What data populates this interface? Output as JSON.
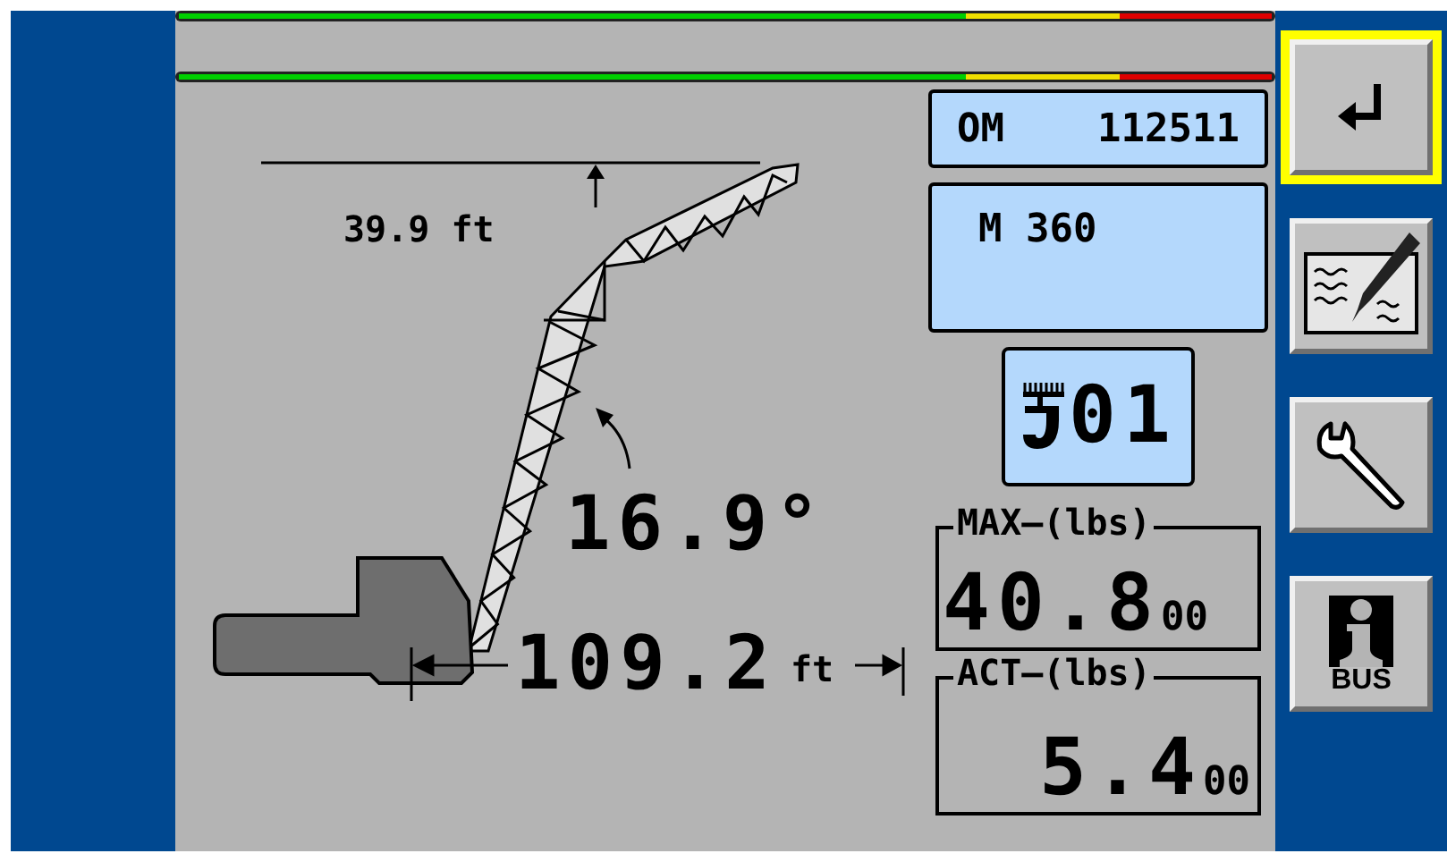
{
  "diagram": {
    "height": "39.9 ft",
    "angle": "16.9°",
    "radius": "109.2",
    "radius_unit": "ft"
  },
  "operating_mode": {
    "label": "OM",
    "value": "112511"
  },
  "mode": "M 360",
  "hook": {
    "value": "01"
  },
  "loads": [
    {
      "kind": "max",
      "label": "MAX—(lbs)",
      "value": "40.8",
      "decimals": "00"
    },
    {
      "kind": "act",
      "label": "ACT—(lbs)",
      "value": "5.4",
      "decimals": "00"
    }
  ],
  "function_keys": [
    {
      "kind": "enter",
      "selected": true
    },
    {
      "kind": "edit",
      "selected": false
    },
    {
      "kind": "tools",
      "selected": false
    },
    {
      "kind": "bus-info",
      "label": "BUS",
      "selected": false
    }
  ]
}
